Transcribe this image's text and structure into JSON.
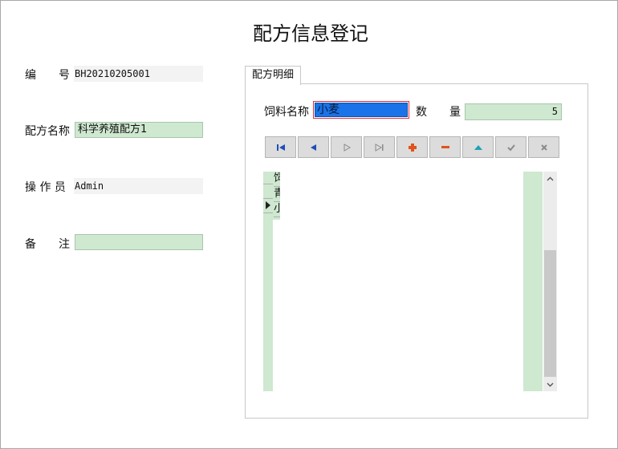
{
  "window": {
    "title": "配方信息登记"
  },
  "form": {
    "code": {
      "label": "编　　号",
      "value": "BH20210205001"
    },
    "formula_name": {
      "label": "配方名称",
      "value": "科学养殖配方1"
    },
    "operator": {
      "label": "操 作 员",
      "value": "Admin"
    },
    "remark": {
      "label": "备　　注",
      "value": ""
    }
  },
  "detail": {
    "tab_label": "配方明细",
    "feed_name": {
      "label": "饲料名称",
      "value": "小麦"
    },
    "quantity": {
      "label": "数　　量",
      "value": "5"
    },
    "navigator": [
      {
        "name": "first-record",
        "icon": "first-icon"
      },
      {
        "name": "prior-record",
        "icon": "prior-icon"
      },
      {
        "name": "next-record",
        "icon": "next-icon"
      },
      {
        "name": "last-record",
        "icon": "last-icon"
      },
      {
        "name": "insert-record",
        "icon": "plus-icon"
      },
      {
        "name": "delete-record",
        "icon": "minus-icon"
      },
      {
        "name": "edit-record",
        "icon": "up-triangle-icon"
      },
      {
        "name": "post-record",
        "icon": "check-icon"
      },
      {
        "name": "cancel-record",
        "icon": "cross-icon"
      }
    ],
    "grid": {
      "header": "饲",
      "rows": [
        "青",
        "小"
      ]
    }
  },
  "colors": {
    "edit_bg": "#cfe8d0",
    "readonly_bg": "#f3f3f3",
    "selection_bg": "#1a73e8",
    "selection_border": "#e0303a"
  }
}
